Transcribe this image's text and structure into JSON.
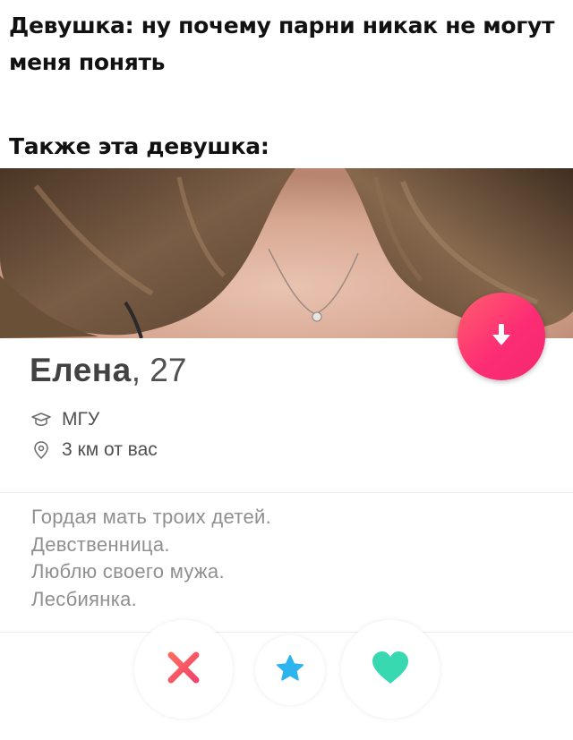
{
  "meme": {
    "caption_top": "Девушка: ну почему парни  никак не могут меня понять",
    "caption_bottom": "Также эта девушка:"
  },
  "profile": {
    "name": "Елена",
    "age_text": ", 27",
    "school": "МГУ",
    "distance": "3 км от вас",
    "bio_lines": [
      "Гордая мать троих детей.",
      "Девственница.",
      "Люблю своего мужа.",
      "Лесбиянка."
    ]
  },
  "icons": {
    "fab": "arrow-down-icon",
    "school": "graduation-cap-icon",
    "distance": "location-pin-icon",
    "dislike": "x-icon",
    "superlike": "star-icon",
    "like": "heart-icon"
  },
  "colors": {
    "fab_gradient_start": "#ff5f6d",
    "fab_gradient_end": "#f4276e",
    "dislike": "#f0456a",
    "superlike": "#2db4ee",
    "like": "#38d9b0"
  }
}
